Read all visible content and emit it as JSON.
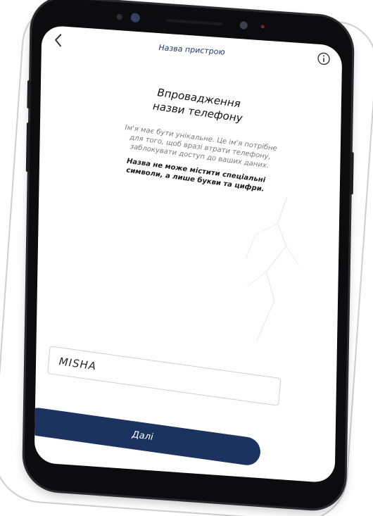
{
  "app": {
    "nav_title": "Назва пристрою",
    "back_icon": "chevron-left-icon",
    "info_icon": "info-circle-icon"
  },
  "main": {
    "heading_lines": [
      "Впровадження",
      "назви телефону"
    ],
    "description_lines": [
      "Ім'я має бути унікальне. Це ім'я потрібне",
      "для того, щоб вразі втрати телефону,",
      "заблокувати доступ до ваших даних."
    ],
    "warning_lines": [
      "Назва не може містити спеціальні",
      "символи, а лише букви та цифри."
    ]
  },
  "form": {
    "device_name_value": "MISHA"
  },
  "actions": {
    "next_label": "Далі"
  },
  "colors": {
    "accent": "#1c335f",
    "nav_title": "#1f3b6f",
    "phone_body": "#0c0c0e"
  }
}
